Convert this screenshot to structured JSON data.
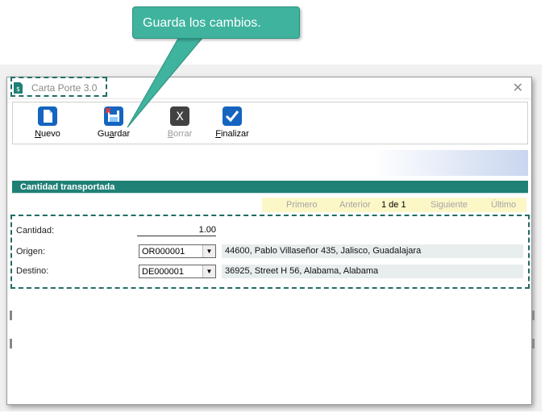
{
  "callout": {
    "text": "Guarda los cambios."
  },
  "window": {
    "title": "Carta Porte 3.0"
  },
  "toolbar": {
    "nuevo": {
      "pre": "",
      "key": "N",
      "post": "uevo"
    },
    "guardar": {
      "pre": "Gu",
      "key": "a",
      "post": "rdar"
    },
    "borrar": {
      "pre": "",
      "key": "B",
      "post": "orrar"
    },
    "finalizar": {
      "pre": "",
      "key": "F",
      "post": "inalizar"
    }
  },
  "section": {
    "title": "Cantidad transportada"
  },
  "pager": {
    "first": "Primero",
    "previous": "Anterior",
    "current": "1 de 1",
    "next": "Siguiente",
    "last": "Último"
  },
  "form": {
    "cantidad_label": "Cantidad:",
    "cantidad_value": "1.00",
    "origen_label": "Origen:",
    "origen_value": "OR000001",
    "origen_address": "44600, Pablo Villaseñor 435, Jalisco, Guadalajara",
    "destino_label": "Destino:",
    "destino_value": "DE000001",
    "destino_address": "36925, Street H 56, Alabama, Alabama"
  },
  "colors": {
    "accent": "#1f8076",
    "callout": "#3fb39e",
    "pager_bg": "#fbf7c7",
    "highlight": "#1f6e64"
  }
}
